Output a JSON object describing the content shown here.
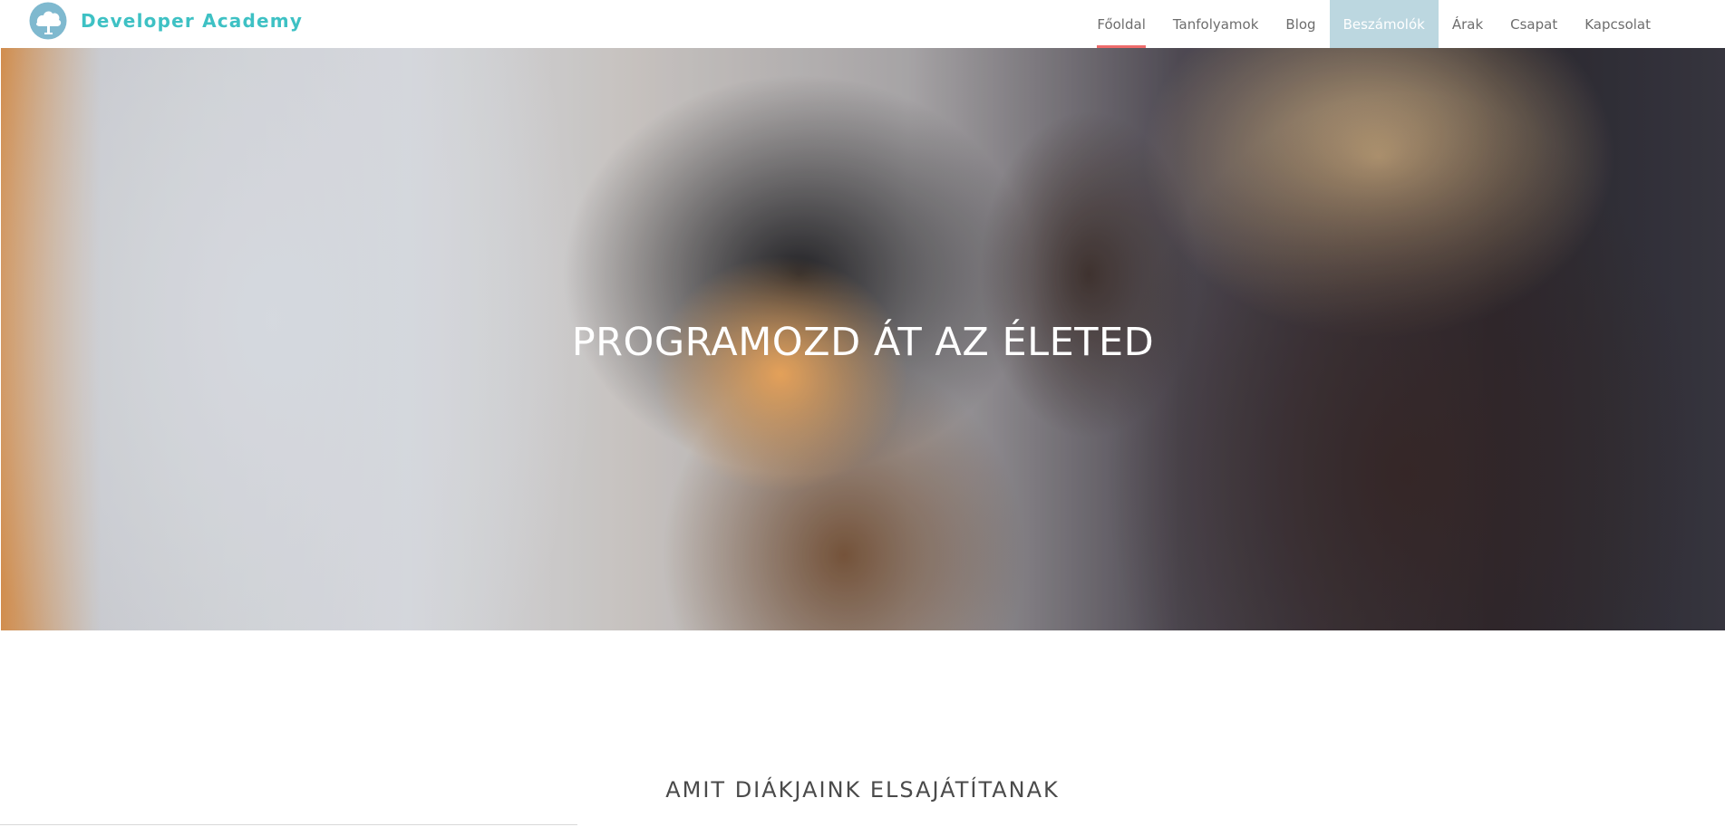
{
  "header": {
    "brand_name": "Developer Academy",
    "brand_icon": "tree-logo-icon",
    "accent_color": "#3ec1c4",
    "nav": [
      {
        "label": "Főoldal",
        "state": "active"
      },
      {
        "label": "Tanfolyamok",
        "state": "normal"
      },
      {
        "label": "Blog",
        "state": "normal"
      },
      {
        "label": "Beszámolók",
        "state": "highlighted"
      },
      {
        "label": "Árak",
        "state": "normal"
      },
      {
        "label": "Csapat",
        "state": "normal"
      },
      {
        "label": "Kapcsolat",
        "state": "normal"
      }
    ],
    "active_underline_color": "#ee6b6b",
    "highlight_color": "#bcd7e0"
  },
  "hero": {
    "title": "PROGRAMOZD ÁT AZ ÉLETED",
    "image": "photo-of-laughing-women"
  },
  "section": {
    "title": "AMIT DIÁKJAINK ELSAJÁTÍTANAK"
  }
}
